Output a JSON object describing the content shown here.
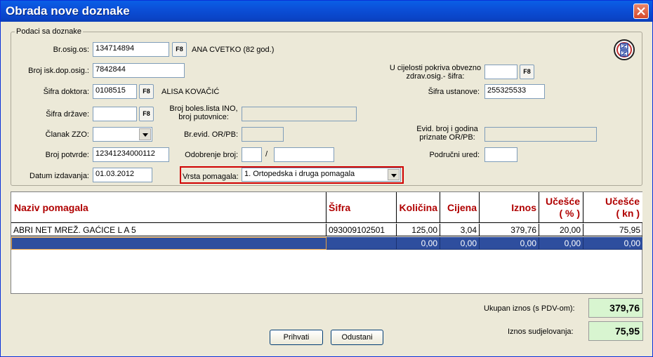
{
  "window": {
    "title": "Obrada nove doznake"
  },
  "group": {
    "legend": "Podaci sa doznake"
  },
  "fields": {
    "br_osig_label": "Br.osig.os:",
    "br_osig_value": "134714894",
    "patient_name": "ANA CVETKO (82 god.)",
    "broj_isk_label": "Broj isk.dop.osig.:",
    "broj_isk_value": "7842844",
    "sifra_doktora_label": "Šifra doktora:",
    "sifra_doktora_value": "0108515",
    "doctor_name": "ALISA KOVAČIĆ",
    "sifra_drzave_label": "Šifra države:",
    "sifra_drzave_value": "",
    "broj_boles_label": "Broj boles.lista INO, broj putovnice:",
    "clanak_label": "Članak ZZO:",
    "br_evid_label": "Br.evid. OR/PB:",
    "broj_potvrde_label": "Broj potvrde:",
    "broj_potvrde_value": "12341234000112",
    "odobrenje_label": "Odobrenje broj:",
    "odobrenje_sep": "/",
    "datum_label": "Datum izdavanja:",
    "datum_value": "01.03.2012",
    "vrsta_label": "Vrsta pomagala:",
    "vrsta_value": "1. Ortopedska i druga pomagala",
    "u_cijelosti_label": "U cijelosti pokriva obvezno zdrav.osig.- šifra:",
    "sifra_ustanove_label": "Šifra ustanove:",
    "sifra_ustanove_value": "255325533",
    "evid_broj_label": "Evid. broj i godina priznate OR/PB:",
    "podrucni_label": "Područni ured:",
    "lookup_icon_text": "F8"
  },
  "grid": {
    "headers": [
      "Naziv pomagala",
      "Šifra",
      "Količina",
      "Cijena",
      "Iznos",
      "Učešće ( % )",
      "Učešće ( kn )"
    ],
    "hdr_ucesce": "Učešće",
    "hdr_pct": "( % )",
    "hdr_kn": "( kn )",
    "rows": [
      [
        "ABRI NET MREŽ. GAĆICE L A 5",
        "093009102501",
        "125,00",
        "3,04",
        "379,76",
        "20,00",
        "75,95"
      ],
      [
        "",
        "",
        "0,00",
        "0,00",
        "0,00",
        "0,00",
        "0,00"
      ]
    ]
  },
  "totals": {
    "ukupan_label": "Ukupan iznos (s PDV-om):",
    "ukupan_value": "379,76",
    "sudjelovanje_label": "Iznos sudjelovanja:",
    "sudjelovanje_value": "75,95"
  },
  "buttons": {
    "prihvati": "Prihvati",
    "odustani": "Odustani"
  }
}
